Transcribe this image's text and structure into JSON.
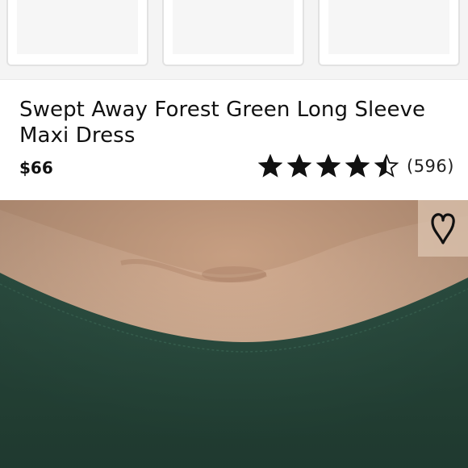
{
  "product": {
    "title": "Swept Away Forest Green Long Sleeve Maxi Dress",
    "price": "$66",
    "rating": 4.5,
    "rating_max": 5,
    "review_count": "(596)"
  },
  "thumbnails": [
    {
      "name": "thumbnail-1"
    },
    {
      "name": "thumbnail-2"
    },
    {
      "name": "thumbnail-3"
    }
  ],
  "photo": {
    "subject": "model-neckline-closeup",
    "dress_color": "#2c4d40"
  },
  "icons": {
    "favorite": "heart-outline-icon",
    "star": "star-icon"
  }
}
